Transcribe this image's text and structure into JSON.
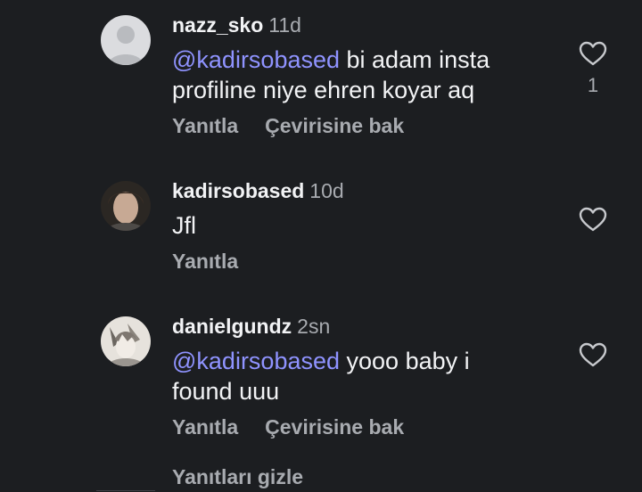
{
  "comments": [
    {
      "username": "nazz_sko",
      "time": "11d",
      "mention": "@kadirsobased",
      "text_line1": " bi adam insta",
      "text_line2": "profiline niye ehren koyar aq",
      "reply_label": "Yanıtla",
      "translate_label": "Çevirisine bak",
      "like_count": "1",
      "avatar": "default-avatar-icon"
    },
    {
      "username": "kadirsobased",
      "time": "10d",
      "text": "Jfl",
      "reply_label": "Yanıtla",
      "avatar": "profile-photo"
    },
    {
      "username": "danielgundz",
      "time": "2sn",
      "mention": "@kadirsobased",
      "text_line1": " yooo baby i",
      "text_line2": "found uuu",
      "reply_label": "Yanıtla",
      "translate_label": "Çevirisine bak",
      "avatar": "profile-photo"
    }
  ],
  "hide_replies_label": "Yanıtları gizle",
  "colors": {
    "background": "#1c1e21",
    "text": "#f2f3f5",
    "muted": "#a8abb0",
    "mention": "#8f93ff"
  }
}
